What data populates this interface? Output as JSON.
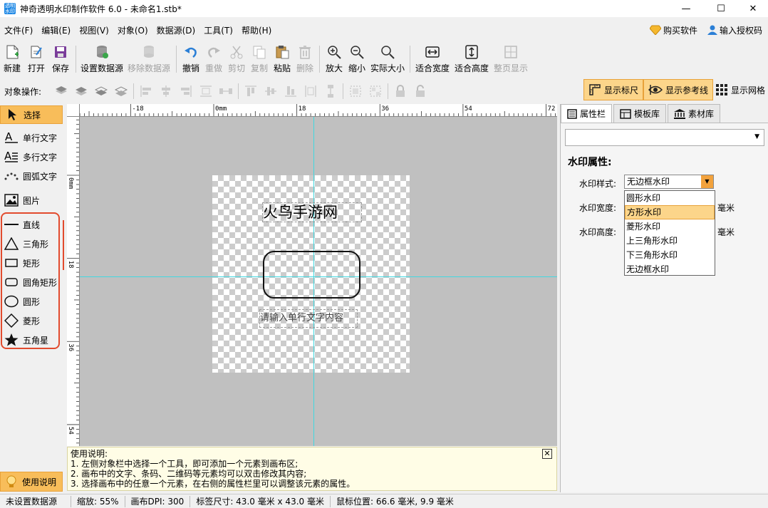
{
  "window": {
    "title": "神奇透明水印制作软件 6.0 - 未命名1.stb*",
    "icon_text": "透明水印",
    "min": "—",
    "max": "☐",
    "close": "✕"
  },
  "menu": {
    "items": [
      "文件(F)",
      "编辑(E)",
      "视图(V)",
      "对象(O)",
      "数据源(D)",
      "工具(T)",
      "帮助(H)"
    ],
    "buy": "购买软件",
    "license": "输入授权码"
  },
  "toolbar": {
    "new": "新建",
    "open": "打开",
    "save": "保存",
    "set_datasource": "设置数据源",
    "remove_datasource": "移除数据源",
    "undo": "撤销",
    "redo": "重做",
    "cut": "剪切",
    "copy": "复制",
    "paste": "粘贴",
    "delete": "删除",
    "zoom_in": "放大",
    "zoom_out": "缩小",
    "actual_size": "实际大小",
    "fit_width": "适合宽度",
    "fit_height": "适合高度",
    "page_display": "整页显示"
  },
  "objbar": {
    "label": "对象操作:",
    "show_ruler": "显示标尺",
    "show_guides": "显示参考线",
    "show_grid": "显示网格"
  },
  "tools": {
    "select": "选择",
    "single_text": "单行文字",
    "multi_text": "多行文字",
    "arc_text": "圆弧文字",
    "image": "图片",
    "line": "直线",
    "triangle": "三角形",
    "rect": "矩形",
    "round_rect": "圆角矩形",
    "circle": "圆形",
    "diamond": "菱形",
    "star": "五角星",
    "help": "使用说明"
  },
  "ruler": {
    "top_labels": [
      "-18",
      "0mm",
      "18",
      "36",
      "54",
      "72"
    ],
    "left_labels": [
      "0mm",
      "18",
      "36",
      "54"
    ]
  },
  "canvas": {
    "main_text": "火鸟手游网",
    "single_text": "请输入单行文字内容"
  },
  "instructions": {
    "title": "使用说明:",
    "line1": "1. 左侧对象栏中选择一个工具，即可添加一个元素到画布区;",
    "line2": "2. 画布中的文字、条码、二维码等元素均可以双击修改其内容;",
    "line3": "3. 选择画布中的任意一个元素，在右侧的属性栏里可以调整该元素的属性。",
    "close": "✕"
  },
  "panel": {
    "tabs": [
      "属性栏",
      "模板库",
      "素材库"
    ],
    "props_title": "水印属性:",
    "style_label": "水印样式:",
    "style_value": "无边框水印",
    "width_label": "水印宽度:",
    "height_label": "水印高度:",
    "unit": "毫米",
    "options": [
      "圆形水印",
      "方形水印",
      "菱形水印",
      "上三角形水印",
      "下三角形水印",
      "无边框水印"
    ],
    "selected_option_index": 1
  },
  "status": {
    "datasource": "未设置数据源",
    "zoom": "缩放: 55%",
    "dpi": "画布DPI: 300",
    "label_size": "标签尺寸: 43.0 毫米 x 43.0 毫米",
    "mouse": "鼠标位置: 66.6 毫米, 9.9 毫米"
  },
  "colors": {
    "accent": "#f8bd5a",
    "guide": "#40d8e0",
    "highlight_border": "#e24b2e"
  }
}
